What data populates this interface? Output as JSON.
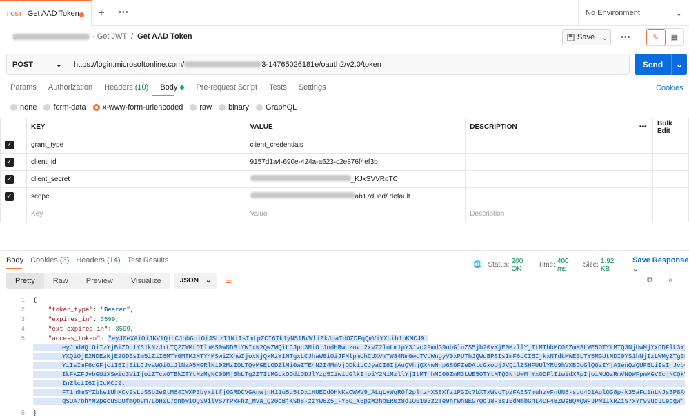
{
  "tab": {
    "method": "POST",
    "title": "Get AAD Token"
  },
  "env": {
    "label": "No Environment"
  },
  "breadcrumb": {
    "parent": "- Get JWT",
    "sep": "/",
    "current": "Get AAD Token"
  },
  "toolbar": {
    "save": "Save"
  },
  "request": {
    "method": "POST",
    "url_start": "https://login.microsoftonline.com/",
    "url_end": "3-14765026181e/oauth2/v2.0/token",
    "send": "Send"
  },
  "req_tabs": {
    "params": "Params",
    "authorization": "Authorization",
    "headers": "Headers",
    "headers_count": "(10)",
    "body": "Body",
    "prerequest": "Pre-request Script",
    "tests": "Tests",
    "settings": "Settings",
    "cookies": "Cookies"
  },
  "body_types": {
    "none": "none",
    "form_data": "form-data",
    "urlencoded": "x-www-form-urlencoded",
    "raw": "raw",
    "binary": "binary",
    "graphql": "GraphQL"
  },
  "table": {
    "key": "KEY",
    "value": "VALUE",
    "description": "DESCRIPTION",
    "bulk": "Bulk Edit",
    "placeholder_key": "Key",
    "placeholder_value": "Value",
    "placeholder_desc": "Description",
    "rows": [
      {
        "key": "grant_type",
        "value": "client_credentials"
      },
      {
        "key": "client_id",
        "value": "9157d1a4-690e-424a-a623-c2e876f4ef3b"
      },
      {
        "key": "client_secret",
        "value": "_KJxSVVRoTC"
      },
      {
        "key": "scope",
        "value": "ab17d0ed/.default"
      }
    ]
  },
  "response": {
    "body": "Body",
    "cookies": "Cookies",
    "cookies_count": "(3)",
    "headers": "Headers",
    "headers_count": "(14)",
    "results": "Test Results",
    "status_label": "Status:",
    "status": "200 OK",
    "time_label": "Time:",
    "time": "400 ms",
    "size_label": "Size:",
    "size": "1.92 KB",
    "save": "Save Response"
  },
  "viewer": {
    "pretty": "Pretty",
    "raw": "Raw",
    "preview": "Preview",
    "visualize": "Visualize",
    "format": "JSON"
  },
  "json": {
    "l1": "{",
    "k_type": "\"token_type\"",
    "v_type": "\"Bearer\"",
    "k_exp": "\"expires_in\"",
    "v_exp": "3599",
    "k_ext": "\"ext_expires_in\"",
    "v_ext": "3599",
    "k_tok": "\"access_token\"",
    "v_tok": "\"eyJ0eXAiOiJKV1QiLCJhbGciOiJSUzI1NiIsImtpZCI6Ik1yNS1BVWliZkJpaTdOZDFqQmViYXhib1hKMCJ9.",
    "tok2": "eyJhdWQiOiIzYjBiZDc1YS1kNzJmLTQ2ZWMtOTlmMS0wNDBiYWIxN2QwZWQiLCJpc3MiOiJodHRwczovL2xvZ2luLm1pY3Jvc29mdG9ubGluZS5jb20vYjE0MzllYjItMThhMC00ZmM3LWE5OTYtMTQ3NjUwMjYxODFlL3YyLjAiLCJp",
    "tok3": "YXQiOjE2NDEzNjE2ODEsIm5iZiI6MTY0MTM2MTY4MSwiZXhwIjoxNjQxMzY1NTgxLCJhaW8iOiJFMlpmUhCUXVmTW84Nm0wcTVuWngyV0xPUThJQWdBPSIsImF6cCI6IjkxNTdkMWE0LTY5MGUtNDI0YS1hNjIzLWMyZTg3NmY0ZWYz",
    "tok4": "YiIsImF6cGFjciI6IjEiLCJvaWQiOiJlNzA5MGRlNi02MzI0LTQyMGEtODZlMi0wZTE4N2I4MmVjODkiLCJyaCI6IjAuQVhjQXNwNnp6S0FZeDAtcGxoUjJVQ1lZSHFUUlYRU9hVXBDcGlQQzIYjA3enQzQUFBLiIsInJvbGVzIjpb",
    "tok5": "IkFkZFJvbGUiXSwic3ViIjoiZTcwOTBkZTYtMzMyNC00MjBhLTg2ZTItMGUxODdiODJlYzg5IiwidGlkIjoiY2NiMzllYjItMThhMC00ZmM3LWE5OTYtMTQ3NjUwMjYxODFlIiwidXRpIjoiMUQzRmVNQWFpmMGVScjNCQkVoR1dBZyIs",
    "tok6": "InZlciI6IjIuMCJ9.",
    "tok7": "FT1n9mSYZbke1UhXCv9sLoSSb2e9tM64IWXP3byxitfj0GRDCVGAnwjnH11u5d5tDx1HUECd0HkKaCWWV9_ALqLvWgROf2plrzHXS8Xfz1PGIc7bXTxWvoTpzFAES7muhzvFnUN6-soc4D1AulOG8p-k35aFq1nLNJsBP8AQLBtRPxsT",
    "tok8": "gSOA7bhYM2pecuSDOfmQbvm7LoH0L7dnbWiOQS9ilvS7rPxFhz_Mva_Q20oBjKSb8-zzYw6Z5_-Y5O_X6pzM2hbER0z8dIOE103z2Te9hrWhNEG7QoJ8-3sIEdMmbGnL4DF4BZWsBQMQwFJPN1IXRZiS7xYr99ucJLecgw\"",
    "last": "}"
  }
}
